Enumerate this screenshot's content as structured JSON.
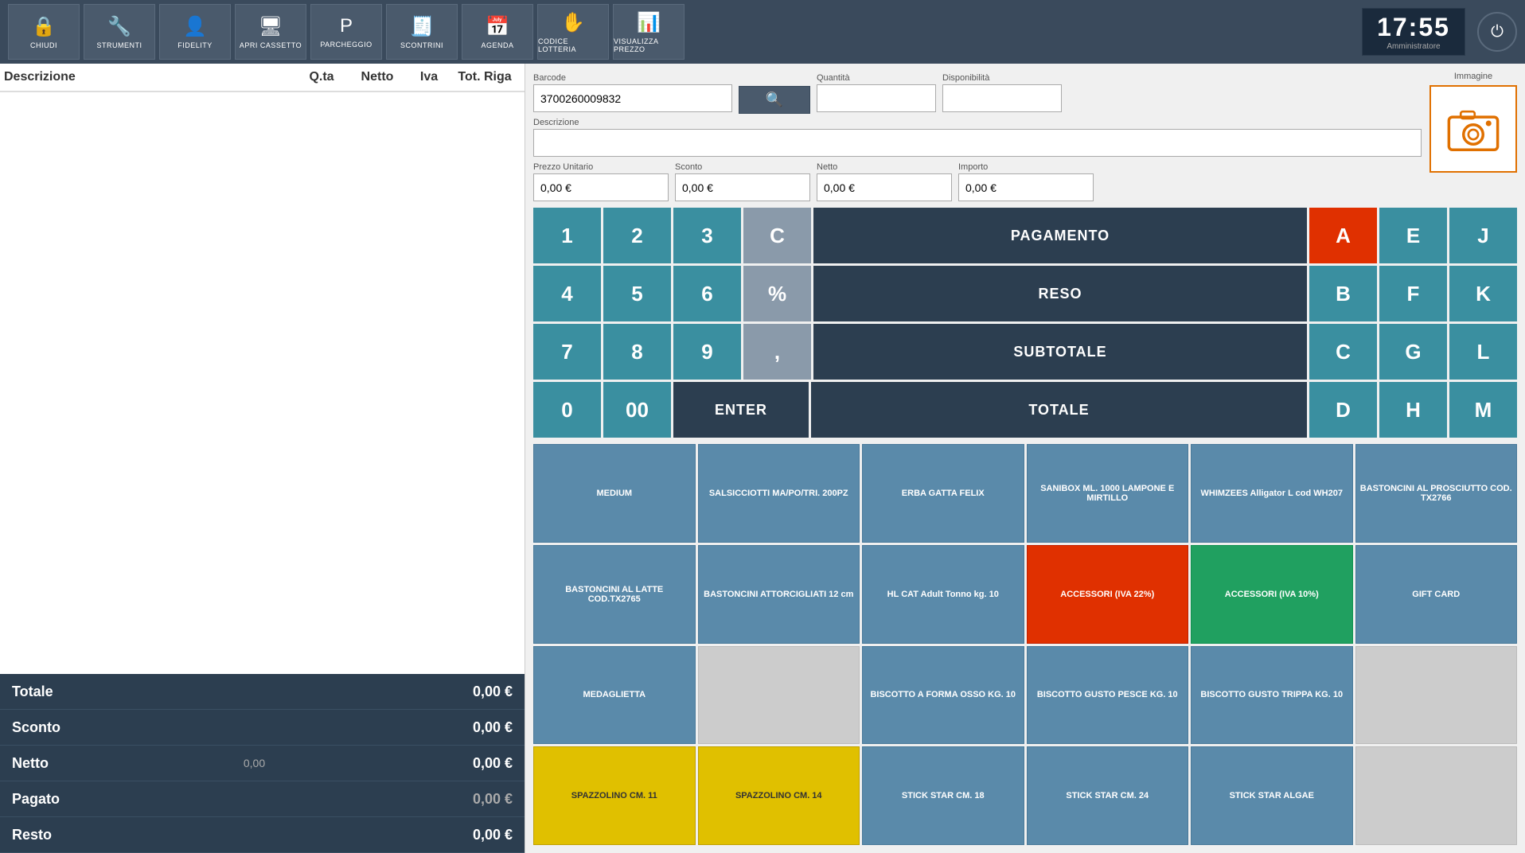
{
  "toolbar": {
    "buttons": [
      {
        "id": "chiudi",
        "label": "CHIUDI",
        "icon": "🔒"
      },
      {
        "id": "strumenti",
        "label": "STRUMENTI",
        "icon": "🔧"
      },
      {
        "id": "fidelity",
        "label": "FIDELITY",
        "icon": "👤"
      },
      {
        "id": "apri-cassetto",
        "label": "APRI CASSETTO",
        "icon": "🖥"
      },
      {
        "id": "parcheggio",
        "label": "PARCHEGGIO",
        "icon": "P"
      },
      {
        "id": "scontrini",
        "label": "SCONTRINI",
        "icon": "🧾"
      },
      {
        "id": "agenda",
        "label": "AGENDA",
        "icon": "📅"
      },
      {
        "id": "codice-lotteria",
        "label": "CODICE LOTTERIA",
        "icon": "✋"
      },
      {
        "id": "visualizza-prezzo",
        "label": "VISUALIZZA PREZZO",
        "icon": "📊"
      }
    ],
    "clock": "17:55",
    "user": "Amministratore",
    "power_label": "⏻"
  },
  "table_header": {
    "descrizione": "Descrizione",
    "qty": "Q.ta",
    "netto": "Netto",
    "iva": "Iva",
    "tot_riga": "Tot. Riga"
  },
  "totals": [
    {
      "label": "Totale",
      "middle": "",
      "value": "0,00 €"
    },
    {
      "label": "Sconto",
      "middle": "",
      "value": "0,00 €"
    },
    {
      "label": "Netto",
      "middle": "0,00",
      "value": "0,00 €"
    },
    {
      "label": "Pagato",
      "middle": "",
      "value": "0,00 €",
      "muted": true
    },
    {
      "label": "Resto",
      "middle": "",
      "value": "0,00 €"
    }
  ],
  "barcode_area": {
    "barcode_label": "Barcode",
    "barcode_value": "3700260009832",
    "qty_label": "Quantità",
    "qty_value": "",
    "disp_label": "Disponibilità",
    "disp_value": "",
    "immagine_label": "Immagine",
    "desc_label": "Descrizione",
    "desc_value": "",
    "prezzo_label": "Prezzo Unitario",
    "prezzo_value": "0,00 €",
    "sconto_label": "Sconto",
    "sconto_value": "0,00 €",
    "netto_label": "Netto",
    "netto_value": "0,00 €",
    "importo_label": "Importo",
    "importo_value": "0,00 €"
  },
  "keypad": {
    "buttons": [
      {
        "label": "1",
        "type": "teal"
      },
      {
        "label": "2",
        "type": "teal"
      },
      {
        "label": "3",
        "type": "teal"
      },
      {
        "label": "C",
        "type": "gray"
      },
      {
        "label": "PAGAMENTO",
        "type": "dark wide"
      },
      {
        "label": "A",
        "type": "red"
      },
      {
        "label": "E",
        "type": "teal"
      },
      {
        "label": "J",
        "type": "teal"
      },
      {
        "label": "4",
        "type": "teal"
      },
      {
        "label": "5",
        "type": "teal"
      },
      {
        "label": "6",
        "type": "teal"
      },
      {
        "label": "%",
        "type": "gray"
      },
      {
        "label": "RESO",
        "type": "dark wide"
      },
      {
        "label": "B",
        "type": "teal"
      },
      {
        "label": "F",
        "type": "teal"
      },
      {
        "label": "K",
        "type": "teal"
      },
      {
        "label": "7",
        "type": "teal"
      },
      {
        "label": "8",
        "type": "teal"
      },
      {
        "label": "9",
        "type": "teal"
      },
      {
        "label": ",",
        "type": "gray"
      },
      {
        "label": "SUBTOTALE",
        "type": "dark wide"
      },
      {
        "label": "C",
        "type": "teal"
      },
      {
        "label": "G",
        "type": "teal"
      },
      {
        "label": "L",
        "type": "teal"
      },
      {
        "label": "0",
        "type": "teal"
      },
      {
        "label": "00",
        "type": "teal"
      },
      {
        "label": "ENTER",
        "type": "dark wide enter"
      },
      {
        "label": "TOTALE",
        "type": "dark wide"
      },
      {
        "label": "D",
        "type": "teal"
      },
      {
        "label": "H",
        "type": "teal"
      },
      {
        "label": "M",
        "type": "teal"
      }
    ]
  },
  "products": [
    {
      "label": "MEDIUM",
      "type": "teal"
    },
    {
      "label": "SALSICCIOTTI MA/PO/TRI. 200PZ",
      "type": "teal"
    },
    {
      "label": "ERBA GATTA FELIX",
      "type": "teal"
    },
    {
      "label": "SANIBOX ML. 1000 LAMPONE E MIRTILLO",
      "type": "teal"
    },
    {
      "label": "WHIMZEES Alligator L cod WH207",
      "type": "teal"
    },
    {
      "label": "BASTONCINI AL PROSCIUTTO COD. TX2766",
      "type": "teal"
    },
    {
      "label": "BASTONCINI AL LATTE COD.TX2765",
      "type": "teal"
    },
    {
      "label": "BASTONCINI ATTORCIGLIATI 12 cm",
      "type": "teal"
    },
    {
      "label": "HL CAT Adult Tonno kg. 10",
      "type": "teal"
    },
    {
      "label": "ACCESSORI (IVA 22%)",
      "type": "red"
    },
    {
      "label": "ACCESSORI (IVA 10%)",
      "type": "green"
    },
    {
      "label": "GIFT CARD",
      "type": "teal"
    },
    {
      "label": "MEDAGLIETTA",
      "type": "teal"
    },
    {
      "label": "",
      "type": "empty"
    },
    {
      "label": "BISCOTTO A FORMA OSSO KG. 10",
      "type": "teal"
    },
    {
      "label": "BISCOTTO GUSTO PESCE KG. 10",
      "type": "teal"
    },
    {
      "label": "BISCOTTO GUSTO TRIPPA KG. 10",
      "type": "teal"
    },
    {
      "label": "",
      "type": "empty"
    },
    {
      "label": "SPAZZOLINO CM. 11",
      "type": "yellow"
    },
    {
      "label": "SPAZZOLINO CM. 14",
      "type": "yellow"
    },
    {
      "label": "STICK STAR CM. 18",
      "type": "teal"
    },
    {
      "label": "STICK STAR CM. 24",
      "type": "teal"
    },
    {
      "label": "STICK STAR ALGAE",
      "type": "teal"
    },
    {
      "label": "",
      "type": "empty"
    }
  ]
}
